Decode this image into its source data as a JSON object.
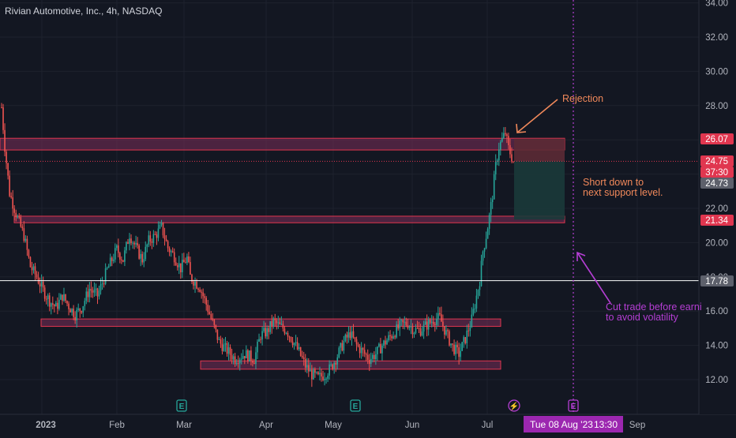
{
  "header": {
    "title": "Rivian Automotive, Inc., 4h, NASDAQ"
  },
  "colors": {
    "background": "#131722",
    "grid": "#1e222d",
    "candle_up": "#26a69a",
    "candle_down": "#ef5350",
    "zone_fill": "#7b2d5a",
    "zone_border": "#e0364f",
    "annotation_orange": "#f0885a",
    "annotation_purple": "#b53ed4",
    "price_line": "#ffffff",
    "short_stop_fill": "#5c2a35",
    "short_target_fill": "#1b3a3a"
  },
  "chart_data": {
    "type": "candlestick",
    "ylim": [
      11.2,
      34.0
    ],
    "ytick_labels": [
      "12.00",
      "14.00",
      "16.00",
      "18.00",
      "20.00",
      "22.00",
      "24.00",
      "26.00",
      "28.00",
      "30.00",
      "32.00",
      "34.00"
    ],
    "ytick_values": [
      12,
      14,
      16,
      18,
      20,
      22,
      24,
      26,
      28,
      30,
      32,
      34
    ],
    "xtick_labels": [
      "2023",
      "Feb",
      "Mar",
      "Apr",
      "May",
      "Jun",
      "Jul",
      "Sep"
    ],
    "price_anchors": [
      [
        0,
        27.9
      ],
      [
        2,
        25.6
      ],
      [
        5,
        22.9
      ],
      [
        10,
        21.4
      ],
      [
        14,
        20.4
      ],
      [
        18,
        18.6
      ],
      [
        22,
        18.0
      ],
      [
        26,
        17.2
      ],
      [
        30,
        16.6
      ],
      [
        34,
        16.2
      ],
      [
        38,
        16.9
      ],
      [
        42,
        16.3
      ],
      [
        46,
        15.8
      ],
      [
        50,
        16.2
      ],
      [
        55,
        17.3
      ],
      [
        60,
        16.9
      ],
      [
        66,
        18.4
      ],
      [
        72,
        19.6
      ],
      [
        76,
        19.0
      ],
      [
        80,
        20.5
      ],
      [
        84,
        19.7
      ],
      [
        88,
        19.0
      ],
      [
        92,
        20.1
      ],
      [
        96,
        20.4
      ],
      [
        100,
        20.9
      ],
      [
        104,
        19.7
      ],
      [
        108,
        19.2
      ],
      [
        112,
        18.5
      ],
      [
        116,
        19.1
      ],
      [
        118,
        18.0
      ],
      [
        124,
        17.4
      ],
      [
        128,
        16.4
      ],
      [
        132,
        15.3
      ],
      [
        136,
        14.2
      ],
      [
        140,
        13.8
      ],
      [
        146,
        13.2
      ],
      [
        152,
        13.5
      ],
      [
        158,
        13.2
      ],
      [
        162,
        14.6
      ],
      [
        166,
        14.8
      ],
      [
        170,
        15.4
      ],
      [
        174,
        15.1
      ],
      [
        178,
        14.9
      ],
      [
        182,
        14.3
      ],
      [
        186,
        13.6
      ],
      [
        190,
        12.8
      ],
      [
        194,
        12.3
      ],
      [
        198,
        12.1
      ],
      [
        202,
        12.3
      ],
      [
        206,
        12.7
      ],
      [
        210,
        13.4
      ],
      [
        214,
        14.2
      ],
      [
        218,
        14.7
      ],
      [
        222,
        14.0
      ],
      [
        226,
        13.6
      ],
      [
        230,
        13.2
      ],
      [
        234,
        13.5
      ],
      [
        238,
        14.0
      ],
      [
        242,
        14.4
      ],
      [
        246,
        14.8
      ],
      [
        250,
        15.2
      ],
      [
        254,
        15.3
      ],
      [
        258,
        14.9
      ],
      [
        262,
        14.9
      ],
      [
        266,
        15.2
      ],
      [
        270,
        15.5
      ],
      [
        274,
        15.6
      ],
      [
        278,
        14.7
      ],
      [
        282,
        13.9
      ],
      [
        286,
        13.5
      ],
      [
        290,
        14.4
      ],
      [
        294,
        15.5
      ],
      [
        296,
        16.4
      ],
      [
        299,
        17.8
      ],
      [
        301,
        19.5
      ],
      [
        303,
        20.4
      ],
      [
        305,
        21.5
      ],
      [
        307,
        22.8
      ],
      [
        309,
        24.5
      ],
      [
        311,
        25.6
      ],
      [
        313,
        26.0
      ],
      [
        315,
        26.4
      ],
      [
        317,
        25.5
      ],
      [
        319,
        25.0
      ],
      [
        320,
        24.73
      ]
    ],
    "levels": {
      "resistance_zone": 26.07,
      "entry": 24.75,
      "support_zone": 21.34,
      "current": 17.78
    },
    "zones": [
      {
        "name": "resistance-zone-top",
        "y1": 26.0,
        "y2": 25.5
      },
      {
        "name": "support-zone-mid",
        "y1": 21.45,
        "y2": 21.25
      },
      {
        "name": "zone-lower-1",
        "y1": 15.45,
        "y2": 15.2
      },
      {
        "name": "zone-lower-2",
        "y1": 13.0,
        "y2": 12.7
      }
    ],
    "short_position": {
      "stop": 26.07,
      "entry": 24.75,
      "target": 21.34
    }
  },
  "price_axis": {
    "labels": [
      {
        "name": "resistance-price-label",
        "value": "26.07",
        "color": "#e0364f",
        "text_color": "#ffffff"
      },
      {
        "name": "entry-price-label",
        "value": "24.75",
        "color": "#e0364f",
        "text_color": "#ffffff"
      },
      {
        "name": "countdown-label",
        "value": "37:30",
        "color": "#e0364f",
        "text_color": "#ffffff"
      },
      {
        "name": "last-price-label",
        "value": "24.73",
        "color": "#5d606b",
        "text_color": "#ffffff"
      },
      {
        "name": "support-price-label",
        "value": "21.34",
        "color": "#e0364f",
        "text_color": "#ffffff"
      },
      {
        "name": "crosshair-price-label",
        "value": "17.78",
        "color": "#5d606b",
        "text_color": "#ffffff"
      }
    ]
  },
  "time_axis": {
    "crosshair_date": "Tue 08 Aug '23",
    "crosshair_time": "13:30"
  },
  "annotations": {
    "rejection": "Rejection",
    "short_line1": "Short down to",
    "short_line2": "next support level.",
    "cut_line1": "Cut trade before earni",
    "cut_line2": "to avoid volatility"
  },
  "event_markers": [
    {
      "name": "earnings-marker",
      "letter": "E"
    },
    {
      "name": "earnings-marker",
      "letter": "E"
    },
    {
      "name": "split-marker",
      "letter": "⚡"
    },
    {
      "name": "earnings-marker",
      "letter": "E"
    }
  ]
}
